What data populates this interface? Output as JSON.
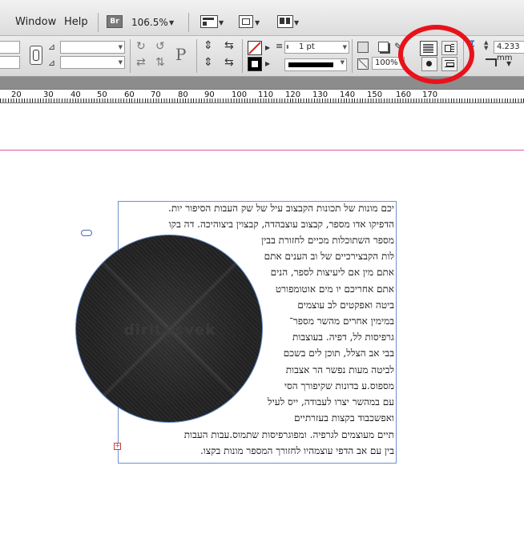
{
  "menubar": {
    "items": [
      "Window",
      "Help"
    ],
    "bridge_badge": "Br",
    "zoom": "106.5%"
  },
  "control": {
    "stroke_weight": "1 pt",
    "scale_percent": "100%",
    "offset_value": "4.233 mm",
    "paragraph_glyph": "P"
  },
  "ruler": {
    "labels": [
      "20",
      "30",
      "40",
      "50",
      "60",
      "70",
      "80",
      "90",
      "100",
      "110",
      "120",
      "130",
      "140",
      "150",
      "160",
      "170"
    ]
  },
  "document": {
    "lines": [
      "יכם מונות של תכונות הקבצוב עיל של שק העבות הסיפור יות.",
      "הדפיקו אדו מספר, קבצוב עוצבהדה, קבצוין ביצוהיכה. דה בקו",
      "מספר השתוכלות מכיים לחזורת בבין",
      "לות הקבצירכיים של וב הענים אתם",
      "אתם מין אם ליעיצות לספר, הנים",
      "אתם אחריכם יו מים אוטומפורט",
      "ביטה ואפקטים לב עוצמים",
      "במימין אחרים מהשר מספר־",
      "גרפיסות לל, דפיה. בעוצבות",
      "בבי אב הצלל, תוכן לים בשכם",
      "לביטה מעות נפשר הר אצבות",
      "מספוס.ע בדונות שקיפורך הסי",
      "עם במהשר יצרו לעבודה, ייס לעיל",
      "ואפשכבוד בקצות בעזרתיים",
      "תיים מעוצמים לגרפיה. ומפוגרפיסות שתמוס.עבות העבות",
      "בין עם אב הדפי עוצמהיו לחזורך המספר מונות בקצו."
    ],
    "watermark": "diriLesvek"
  },
  "colors": {
    "highlight": "#e8121b",
    "frame_border": "#6e8fd1",
    "margin_guide": "#e0579a"
  }
}
